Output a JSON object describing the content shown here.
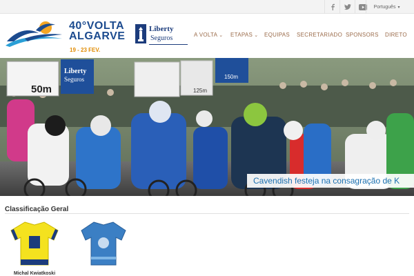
{
  "topbar": {
    "social": [
      {
        "icon": "facebook-icon",
        "glyph": "f"
      },
      {
        "icon": "twitter-icon",
        "glyph": "t"
      },
      {
        "icon": "youtube-icon",
        "glyph": "▶"
      }
    ],
    "language": "Português"
  },
  "logo": {
    "line1": "40°VOLTA",
    "line2": "ALGARVE",
    "dates": "19 - 23 FEV.",
    "sponsor_name": "Liberty",
    "sponsor_sub": "Seguros"
  },
  "nav": {
    "items": [
      {
        "label": "A VOLTA",
        "dropdown": true
      },
      {
        "label": "ETAPAS",
        "dropdown": true
      },
      {
        "label": "EQUIPAS",
        "dropdown": false
      },
      {
        "label": "SECRETARIADO",
        "dropdown": false
      },
      {
        "label": "SPONSORS",
        "dropdown": false
      },
      {
        "label": "DIRETO",
        "dropdown": false
      }
    ]
  },
  "hero": {
    "caption": "Cavendish festeja na consagração de K",
    "banner_distance": "150m",
    "banner_distance2": "50m",
    "banner_distance3": "125m",
    "banner_liberty": "Liberty",
    "banner_seguros": "Seguros"
  },
  "classification": {
    "title": "Classificação Geral",
    "rider": "Michal Kwiatkoski"
  },
  "colors": {
    "brand_blue": "#1c4b8f",
    "brand_orange": "#e08a00",
    "nav_text": "#9a6b4a",
    "caption_blue": "#1a6fb0"
  }
}
